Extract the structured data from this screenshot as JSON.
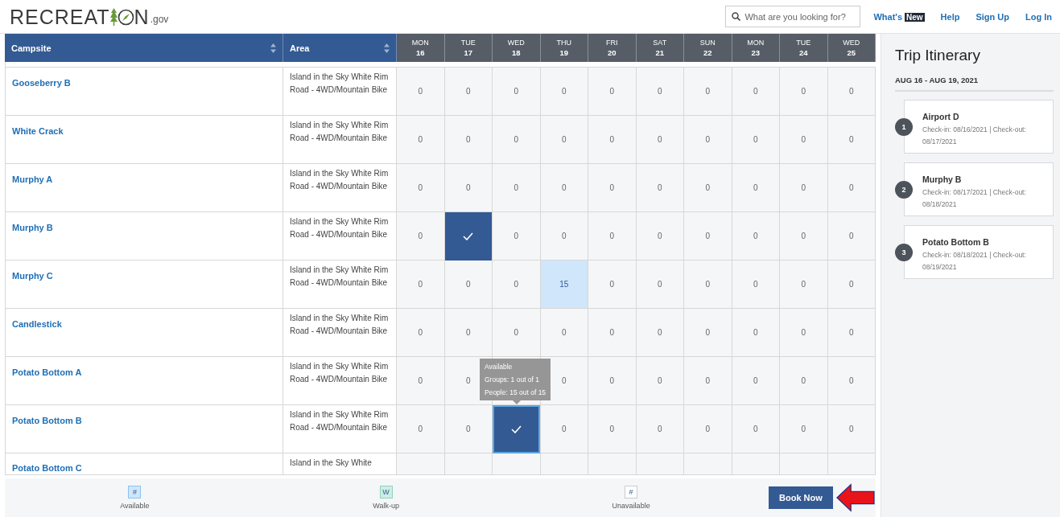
{
  "header": {
    "logo": {
      "prefix": "RECREAT",
      "suffix": "N",
      "domain": ".gov"
    },
    "search": {
      "placeholder": "What are you looking for?"
    },
    "nav": [
      {
        "label": "What's",
        "badge": "New"
      },
      {
        "label": "Help"
      },
      {
        "label": "Sign Up"
      },
      {
        "label": "Log In"
      }
    ]
  },
  "table": {
    "columns": [
      {
        "label": "Campsite"
      },
      {
        "label": "Area"
      }
    ],
    "days": [
      {
        "weekday": "MON",
        "date": "16"
      },
      {
        "weekday": "TUE",
        "date": "17"
      },
      {
        "weekday": "WED",
        "date": "18"
      },
      {
        "weekday": "THU",
        "date": "19"
      },
      {
        "weekday": "FRI",
        "date": "20"
      },
      {
        "weekday": "SAT",
        "date": "21"
      },
      {
        "weekday": "SUN",
        "date": "22"
      },
      {
        "weekday": "MON",
        "date": "23"
      },
      {
        "weekday": "TUE",
        "date": "24"
      },
      {
        "weekday": "WED",
        "date": "25"
      }
    ],
    "rows": [
      {
        "campsite": "Gooseberry B",
        "area": "Island in the Sky White Rim Road - 4WD/Mountain Bike",
        "cells": [
          {
            "kind": "count",
            "text": "0"
          },
          {
            "kind": "count",
            "text": "0"
          },
          {
            "kind": "count",
            "text": "0"
          },
          {
            "kind": "count",
            "text": "0"
          },
          {
            "kind": "count",
            "text": "0"
          },
          {
            "kind": "count",
            "text": "0"
          },
          {
            "kind": "count",
            "text": "0"
          },
          {
            "kind": "count",
            "text": "0"
          },
          {
            "kind": "count",
            "text": "0"
          },
          {
            "kind": "count",
            "text": "0"
          }
        ]
      },
      {
        "campsite": "White Crack",
        "area": "Island in the Sky White Rim Road - 4WD/Mountain Bike",
        "cells": [
          {
            "kind": "count",
            "text": "0"
          },
          {
            "kind": "count",
            "text": "0"
          },
          {
            "kind": "count",
            "text": "0"
          },
          {
            "kind": "count",
            "text": "0"
          },
          {
            "kind": "count",
            "text": "0"
          },
          {
            "kind": "count",
            "text": "0"
          },
          {
            "kind": "count",
            "text": "0"
          },
          {
            "kind": "count",
            "text": "0"
          },
          {
            "kind": "count",
            "text": "0"
          },
          {
            "kind": "count",
            "text": "0"
          }
        ]
      },
      {
        "campsite": "Murphy A",
        "area": "Island in the Sky White Rim Road - 4WD/Mountain Bike",
        "cells": [
          {
            "kind": "count",
            "text": "0"
          },
          {
            "kind": "count",
            "text": "0"
          },
          {
            "kind": "count",
            "text": "0"
          },
          {
            "kind": "count",
            "text": "0"
          },
          {
            "kind": "count",
            "text": "0"
          },
          {
            "kind": "count",
            "text": "0"
          },
          {
            "kind": "count",
            "text": "0"
          },
          {
            "kind": "count",
            "text": "0"
          },
          {
            "kind": "count",
            "text": "0"
          },
          {
            "kind": "count",
            "text": "0"
          }
        ]
      },
      {
        "campsite": "Murphy B",
        "area": "Island in the Sky White Rim Road - 4WD/Mountain Bike",
        "cells": [
          {
            "kind": "count",
            "text": "0"
          },
          {
            "kind": "check",
            "focused": false
          },
          {
            "kind": "count",
            "text": "0"
          },
          {
            "kind": "count",
            "text": "0"
          },
          {
            "kind": "count",
            "text": "0"
          },
          {
            "kind": "count",
            "text": "0"
          },
          {
            "kind": "count",
            "text": "0"
          },
          {
            "kind": "count",
            "text": "0"
          },
          {
            "kind": "count",
            "text": "0"
          },
          {
            "kind": "count",
            "text": "0"
          }
        ]
      },
      {
        "campsite": "Murphy C",
        "area": "Island in the Sky White Rim Road - 4WD/Mountain Bike",
        "cells": [
          {
            "kind": "count",
            "text": "0"
          },
          {
            "kind": "count",
            "text": "0"
          },
          {
            "kind": "count",
            "text": "0"
          },
          {
            "kind": "available",
            "text": "15"
          },
          {
            "kind": "count",
            "text": "0"
          },
          {
            "kind": "count",
            "text": "0"
          },
          {
            "kind": "count",
            "text": "0"
          },
          {
            "kind": "count",
            "text": "0"
          },
          {
            "kind": "count",
            "text": "0"
          },
          {
            "kind": "count",
            "text": "0"
          }
        ]
      },
      {
        "campsite": "Candlestick",
        "area": "Island in the Sky White Rim Road - 4WD/Mountain Bike",
        "cells": [
          {
            "kind": "count",
            "text": "0"
          },
          {
            "kind": "count",
            "text": "0"
          },
          {
            "kind": "count",
            "text": "0"
          },
          {
            "kind": "count",
            "text": "0"
          },
          {
            "kind": "count",
            "text": "0"
          },
          {
            "kind": "count",
            "text": "0"
          },
          {
            "kind": "count",
            "text": "0"
          },
          {
            "kind": "count",
            "text": "0"
          },
          {
            "kind": "count",
            "text": "0"
          },
          {
            "kind": "count",
            "text": "0"
          }
        ]
      },
      {
        "campsite": "Potato Bottom A",
        "area": "Island in the Sky White Rim Road - 4WD/Mountain Bike",
        "cells": [
          {
            "kind": "count",
            "text": "0"
          },
          {
            "kind": "count",
            "text": "0"
          },
          {
            "kind": "covered"
          },
          {
            "kind": "count",
            "text": "0"
          },
          {
            "kind": "count",
            "text": "0"
          },
          {
            "kind": "count",
            "text": "0"
          },
          {
            "kind": "count",
            "text": "0"
          },
          {
            "kind": "count",
            "text": "0"
          },
          {
            "kind": "count",
            "text": "0"
          },
          {
            "kind": "count",
            "text": "0"
          }
        ]
      },
      {
        "campsite": "Potato Bottom B",
        "area": "Island in the Sky White Rim Road - 4WD/Mountain Bike",
        "cells": [
          {
            "kind": "count",
            "text": "0"
          },
          {
            "kind": "count",
            "text": "0"
          },
          {
            "kind": "check",
            "focused": true,
            "tooltip": [
              "Available",
              "Groups: 1 out of 1",
              "People: 15 out of 15"
            ]
          },
          {
            "kind": "count",
            "text": "0"
          },
          {
            "kind": "count",
            "text": "0"
          },
          {
            "kind": "count",
            "text": "0"
          },
          {
            "kind": "count",
            "text": "0"
          },
          {
            "kind": "count",
            "text": "0"
          },
          {
            "kind": "count",
            "text": "0"
          },
          {
            "kind": "count",
            "text": "0"
          }
        ]
      },
      {
        "campsite": "Potato Bottom C",
        "area": "Island in the Sky White",
        "partial": true
      }
    ]
  },
  "legend": [
    {
      "kind": "available",
      "symbol": "#",
      "label": "Available"
    },
    {
      "kind": "walkup",
      "symbol": "W",
      "label": "Walk-up"
    },
    {
      "kind": "unavailable",
      "symbol": "#",
      "label": "Unavailable"
    }
  ],
  "book_button": "Book Now",
  "itinerary": {
    "title": "Trip Itinerary",
    "dates": "AUG 16 - AUG 19, 2021",
    "stops": [
      {
        "number": "1",
        "name": "Airport D",
        "details": "Check-in: 08/16/2021 | Check-out: 08/17/2021"
      },
      {
        "number": "2",
        "name": "Murphy B",
        "details": "Check-in: 08/17/2021 | Check-out: 08/18/2021"
      },
      {
        "number": "3",
        "name": "Potato Bottom B",
        "details": "Check-in: 08/18/2021 | Check-out: 08/19/2021"
      }
    ]
  }
}
